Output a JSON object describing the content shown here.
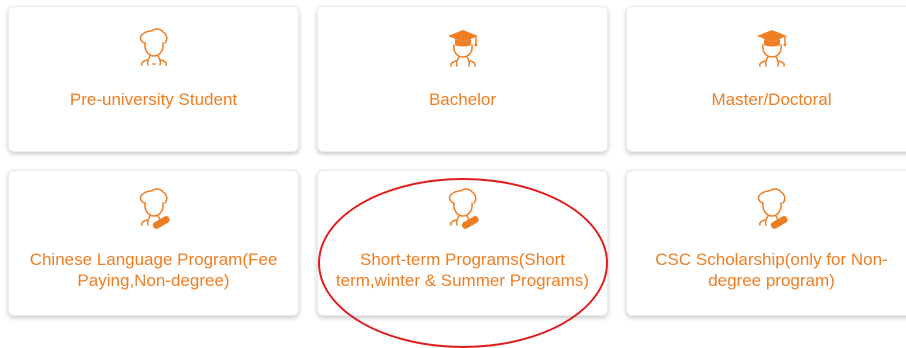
{
  "colors": {
    "accent": "#ef7d22",
    "annotation": "#e01c1c"
  },
  "cards": [
    {
      "label": "Pre-university Student",
      "icon": "student-icon"
    },
    {
      "label": "Bachelor",
      "icon": "graduate-cap-icon"
    },
    {
      "label": "Master/Doctoral",
      "icon": "graduate-cap-icon"
    },
    {
      "label": "Chinese Language Program(Fee Paying,Non-degree)",
      "icon": "graduate-diploma-icon"
    },
    {
      "label": "Short-term Programs(Short term,winter & Summer Programs)",
      "icon": "graduate-diploma-icon"
    },
    {
      "label": "CSC Scholarship(only for Non-degree program)",
      "icon": "graduate-diploma-icon"
    }
  ]
}
